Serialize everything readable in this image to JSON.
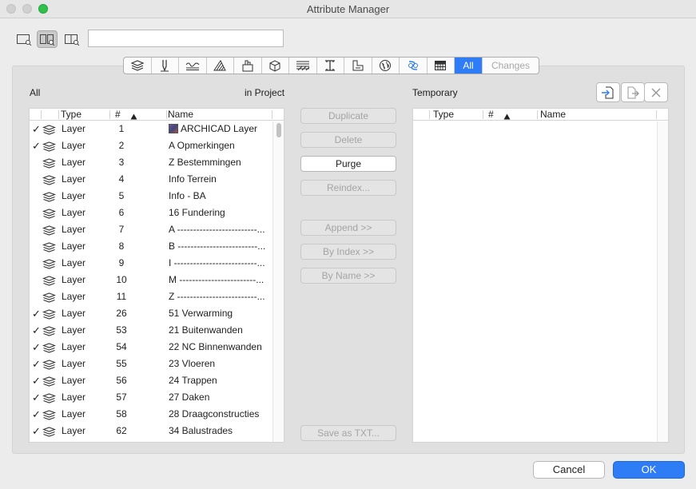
{
  "window": {
    "title": "Attribute Manager"
  },
  "search": {
    "value": "",
    "placeholder": ""
  },
  "tabs": {
    "all_label": "All",
    "changes_label": "Changes"
  },
  "left": {
    "title": "All",
    "subtitle": "in Project",
    "headers": {
      "type": "Type",
      "num": "#",
      "name": "Name"
    },
    "rows": [
      {
        "check": "✓",
        "type": "Layer",
        "num": "1",
        "name": "ARCHICAD Layer"
      },
      {
        "check": "✓",
        "type": "Layer",
        "num": "2",
        "name": "A Opmerkingen"
      },
      {
        "check": "",
        "type": "Layer",
        "num": "3",
        "name": "Z Bestemmingen"
      },
      {
        "check": "",
        "type": "Layer",
        "num": "4",
        "name": "Info Terrein"
      },
      {
        "check": "",
        "type": "Layer",
        "num": "5",
        "name": "Info - BA"
      },
      {
        "check": "",
        "type": "Layer",
        "num": "6",
        "name": "16 Fundering"
      },
      {
        "check": "",
        "type": "Layer",
        "num": "7",
        "name": "A -------------------------..."
      },
      {
        "check": "",
        "type": "Layer",
        "num": "8",
        "name": "B -------------------------..."
      },
      {
        "check": "",
        "type": "Layer",
        "num": "9",
        "name": "I --------------------------..."
      },
      {
        "check": "",
        "type": "Layer",
        "num": "10",
        "name": "M ------------------------..."
      },
      {
        "check": "",
        "type": "Layer",
        "num": "11",
        "name": "Z -------------------------..."
      },
      {
        "check": "✓",
        "type": "Layer",
        "num": "26",
        "name": "51 Verwarming"
      },
      {
        "check": "✓",
        "type": "Layer",
        "num": "53",
        "name": "21 Buitenwanden"
      },
      {
        "check": "✓",
        "type": "Layer",
        "num": "54",
        "name": "22 NC Binnenwanden"
      },
      {
        "check": "✓",
        "type": "Layer",
        "num": "55",
        "name": "23 Vloeren"
      },
      {
        "check": "✓",
        "type": "Layer",
        "num": "56",
        "name": "24 Trappen"
      },
      {
        "check": "✓",
        "type": "Layer",
        "num": "57",
        "name": "27 Daken"
      },
      {
        "check": "✓",
        "type": "Layer",
        "num": "58",
        "name": "28 Draagconstructies"
      },
      {
        "check": "✓",
        "type": "Layer",
        "num": "62",
        "name": "34 Balustrades"
      }
    ]
  },
  "middle": {
    "duplicate": "Duplicate",
    "delete": "Delete",
    "purge": "Purge",
    "reindex": "Reindex...",
    "append": "Append >>",
    "by_index": "By Index >>",
    "by_name": "By Name >>",
    "save_txt": "Save as TXT..."
  },
  "right": {
    "title": "Temporary",
    "headers": {
      "type": "Type",
      "num": "#",
      "name": "Name"
    }
  },
  "footer": {
    "cancel": "Cancel",
    "ok": "OK"
  },
  "colors": {
    "accent": "#2e7cf6",
    "window_bg": "#ececec",
    "panel_bg": "#e0e0e0"
  }
}
